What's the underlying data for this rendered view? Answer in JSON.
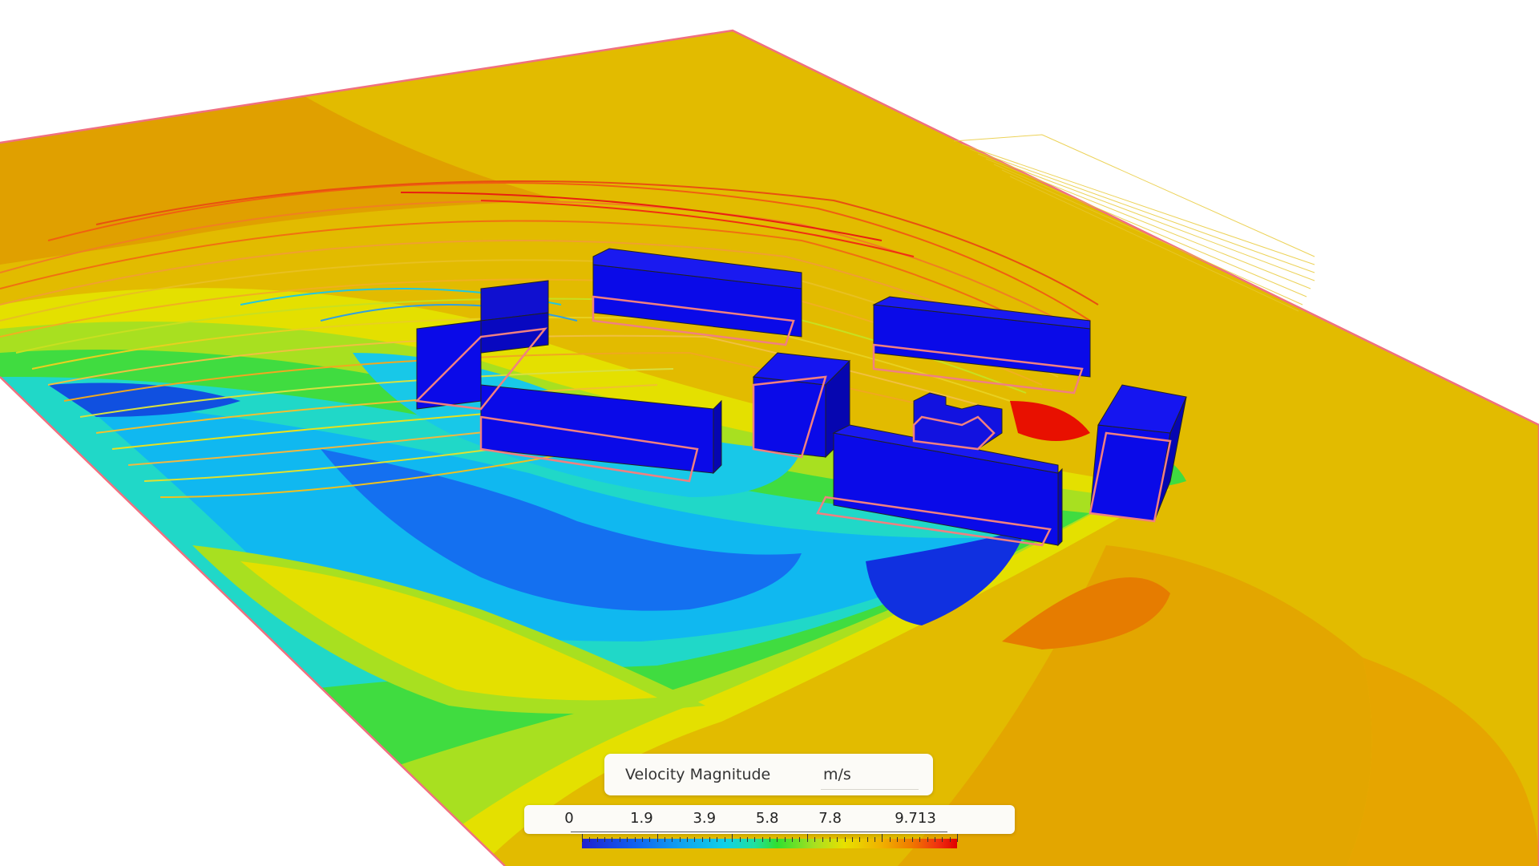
{
  "legend": {
    "title": "Velocity Magnitude",
    "unit": "m/s",
    "ticks": [
      "0",
      "1.9",
      "3.9",
      "5.8",
      "7.8",
      "9.713"
    ]
  },
  "colors": {
    "plane_edge": "#f07080",
    "building": "#0a0ae8",
    "slow_flow": "#1030e0",
    "mid_flow": "#20d8d0",
    "fast_flow": "#e8b000",
    "max_flow": "#e81000"
  }
}
